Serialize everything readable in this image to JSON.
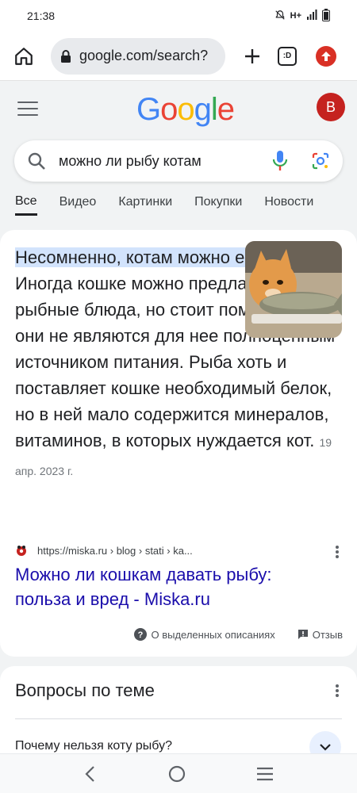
{
  "status_bar": {
    "time": "21:38",
    "network": "H+"
  },
  "browser": {
    "url": "google.com/search?",
    "tabs_icon_label": ":D"
  },
  "google": {
    "logo_letters": [
      "G",
      "o",
      "o",
      "g",
      "l",
      "e"
    ],
    "logo_colors": [
      "#4285F4",
      "#EA4335",
      "#FBBC05",
      "#4285F4",
      "#34A853",
      "#EA4335"
    ],
    "avatar_letter": "B",
    "avatar_color": "#c5221f"
  },
  "search": {
    "query": "можно ли рыбу котам"
  },
  "filters": [
    {
      "label": "Все",
      "active": true
    },
    {
      "label": "Видео"
    },
    {
      "label": "Картинки"
    },
    {
      "label": "Покупки"
    },
    {
      "label": "Новости"
    }
  ],
  "featured": {
    "highlight": "Несомненно, котам можно есть рыбу",
    "highlight_end": ".",
    "body": "Иногда кошке можно предлагать рыбные блюда, но стоит помнить, что они не являются для нее полноценным источником питания. Рыба хоть и поставляет кошке необходимый белок, но в ней мало содержится минералов, витаминов, в которых нуждается кот.",
    "date": "19 апр. 2023 г.",
    "source_url": "https://miska.ru › blog › stati › ka...",
    "link_title": "Можно ли кошкам давать рыбу: польза и вред - Miska.ru",
    "about_label": "О выделенных описаниях",
    "feedback_label": "Отзыв"
  },
  "related": {
    "title": "Вопросы по теме",
    "questions": [
      "Почему нельзя коту рыбу?"
    ]
  },
  "colors": {
    "link": "#1a0dab",
    "highlight": "#d2e3fc"
  }
}
